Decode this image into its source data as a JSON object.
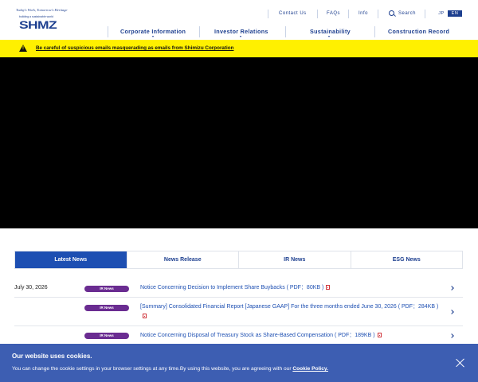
{
  "header": {
    "logo_tagline": "Today's Work, Tomorrow's Heritage",
    "logo_sub": "building a sustainable world",
    "logo_brand": "SHMZ",
    "utility_links": [
      "Contact Us",
      "FAQs",
      "Info",
      "Search"
    ],
    "lang_jp": "JP",
    "lang_en": "EN",
    "main_nav": [
      "Corporate Information",
      "Investor Relations",
      "Sustainability",
      "Construction Record"
    ]
  },
  "alert": {
    "icon": "warning-icon",
    "text": "Be careful of suspicious emails masquerading as emails from Shimizu Corporation"
  },
  "news_tabs": {
    "tabs": [
      "Latest News",
      "News Release",
      "IR News",
      "ESG News"
    ],
    "active": 0
  },
  "news": {
    "items": [
      {
        "date": "July 30, 2026",
        "badge": "IR News",
        "title": "Notice Concerning Decision to Implement Share Buybacks ( PDF：80KB )"
      },
      {
        "date": "",
        "badge": "IR News",
        "title": "[Summary] Consolidated Financial Report [Japanese GAAP] For the three months ended June 30, 2026 ( PDF：284KB )"
      },
      {
        "date": "",
        "badge": "IR News",
        "title": "Notice Concerning Disposal of Treasury Stock as Share-Based Compensation ( PDF：189KB )"
      }
    ]
  },
  "cookie": {
    "title": "Our website uses cookies.",
    "text": "You can change the cookie settings in your browser settings at any time.By using this website, you are agreeing with our ",
    "link": "Cookie Policy."
  },
  "colors": {
    "brand_blue": "#1d3f8f",
    "tab_active": "#1d4fb2",
    "badge_purple": "#6a2c91",
    "alert_yellow": "#fff000"
  }
}
